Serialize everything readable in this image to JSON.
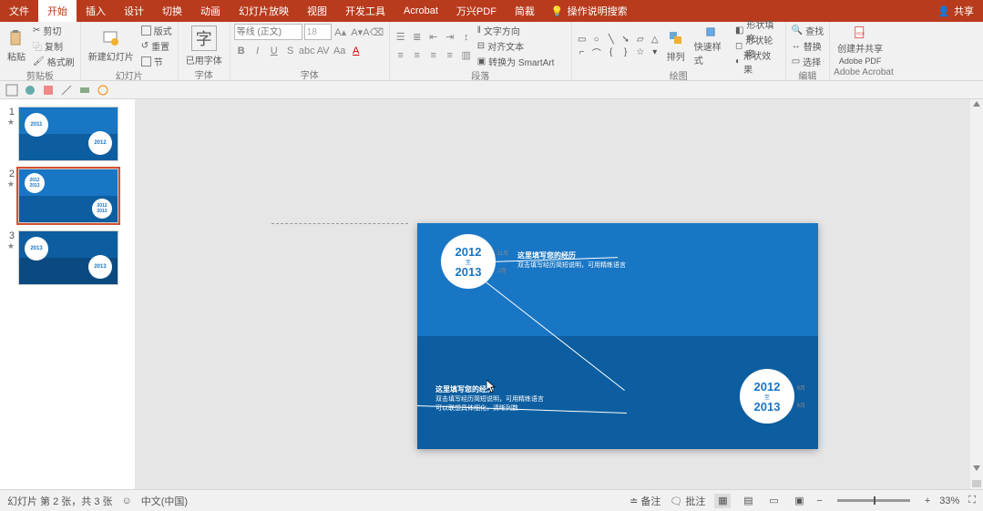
{
  "titlebar": {
    "tabs": [
      "文件",
      "开始",
      "插入",
      "设计",
      "切换",
      "动画",
      "幻灯片放映",
      "视图",
      "开发工具",
      "Acrobat",
      "万兴PDF",
      "简裁"
    ],
    "active_index": 1,
    "tell_me": "操作说明搜索",
    "share": "共享"
  },
  "ribbon": {
    "clipboard": {
      "paste": "粘贴",
      "cut": "剪切",
      "copy": "复制",
      "format_painter": "格式刷",
      "label": "剪贴板"
    },
    "slides": {
      "new_slide": "新建幻灯片",
      "layout": "版式",
      "reset": "重置",
      "section": "节",
      "label": "幻灯片"
    },
    "defaultfont": {
      "btn": "已用字体",
      "label": "字体"
    },
    "font": {
      "placeholder": "等线 (正文)",
      "size": "18",
      "label": "字体"
    },
    "paragraph": {
      "direction": "文字方向",
      "align": "对齐文本",
      "smartart": "转换为 SmartArt",
      "label": "段落"
    },
    "drawing": {
      "arrange": "排列",
      "quick": "快速样式",
      "fill": "形状填充",
      "outline": "形状轮廓",
      "effects": "形状效果",
      "label": "绘图"
    },
    "editing": {
      "find": "查找",
      "replace": "替换",
      "select": "选择",
      "label": "编辑"
    },
    "acrobat": {
      "create": "创建并共享",
      "pdf": "Adobe PDF",
      "label": "Adobe Acrobat"
    }
  },
  "thumbs": {
    "items": [
      {
        "n": "1",
        "y1": "2011",
        "y2": "2012"
      },
      {
        "n": "2",
        "y1": "2012",
        "y2": "2013",
        "y3": "2012",
        "y4": "2013"
      },
      {
        "n": "3",
        "y1": "2013",
        "y2": "2013"
      }
    ],
    "selected": 1
  },
  "slide": {
    "circle1": {
      "y1": "2012",
      "m1": "11月",
      "mid": "至",
      "y2": "2013",
      "m2": "2月"
    },
    "circle2": {
      "y1": "2012",
      "m1": "9月",
      "mid": "至",
      "y2": "2013",
      "m2": "6月"
    },
    "text1": {
      "title": "这里填写您的经历",
      "line": "双击填写经历简短说明，可用精练语言"
    },
    "text2": {
      "title": "这里填写您的经历",
      "line1": "双击填写经历简短说明，可用精练语言",
      "line2": "可以联想具体细化，清晰列数"
    }
  },
  "status": {
    "slide_info": "幻灯片 第 2 张，共 3 张",
    "lang": "中文(中国)",
    "notes": "备注",
    "comments": "批注",
    "zoom": "33%"
  }
}
